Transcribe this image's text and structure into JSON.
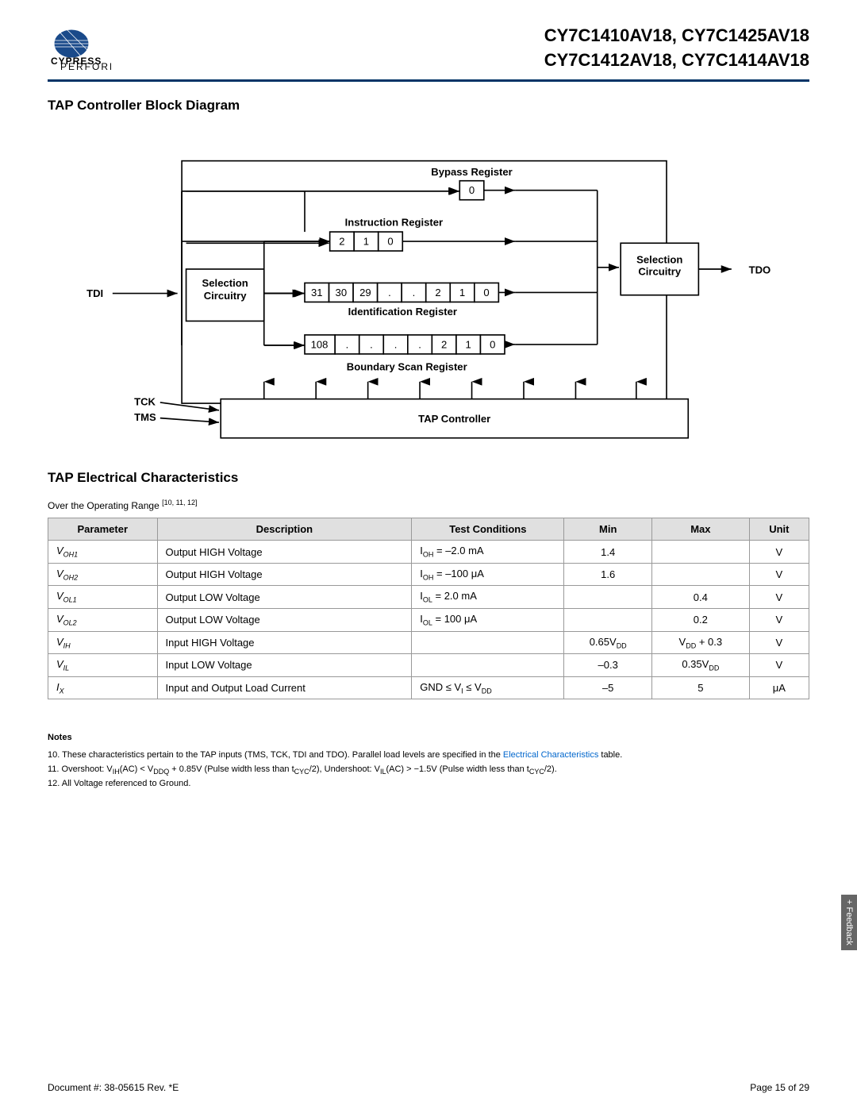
{
  "header": {
    "title_line1": "CY7C1410AV18, CY7C1425AV18",
    "title_line2": "CY7C1412AV18, CY7C1414AV18"
  },
  "diagram_section": {
    "title": "TAP Controller Block Diagram"
  },
  "table_section": {
    "title": "TAP Electrical Characteristics",
    "operating_range": "Over the Operating Range",
    "operating_range_sup": "[10, 11, 12]",
    "columns": [
      "Parameter",
      "Description",
      "Test Conditions",
      "Min",
      "Max",
      "Unit"
    ],
    "rows": [
      {
        "param": "V_OH1",
        "param_display": "V<sub>OH1</sub>",
        "description": "Output HIGH Voltage",
        "test_conditions": "I<sub>OH</sub> = –2.0 mA",
        "min": "1.4",
        "max": "",
        "unit": "V"
      },
      {
        "param": "V_OH2",
        "param_display": "V<sub>OH2</sub>",
        "description": "Output HIGH Voltage",
        "test_conditions": "I<sub>OH</sub> = –100 μA",
        "min": "1.6",
        "max": "",
        "unit": "V"
      },
      {
        "param": "V_OL1",
        "param_display": "V<sub>OL1</sub>",
        "description": "Output LOW Voltage",
        "test_conditions": "I<sub>OL</sub> = 2.0 mA",
        "min": "",
        "max": "0.4",
        "unit": "V"
      },
      {
        "param": "V_OL2",
        "param_display": "V<sub>OL2</sub>",
        "description": "Output LOW Voltage",
        "test_conditions": "I<sub>OL</sub> = 100 μA",
        "min": "",
        "max": "0.2",
        "unit": "V"
      },
      {
        "param": "V_IH",
        "param_display": "V<sub>IH</sub>",
        "description": "Input HIGH Voltage",
        "test_conditions": "",
        "min": "0.65V<sub>DD</sub>",
        "max": "V<sub>DD</sub> + 0.3",
        "unit": "V"
      },
      {
        "param": "V_IL",
        "param_display": "V<sub>IL</sub>",
        "description": "Input LOW Voltage",
        "test_conditions": "",
        "min": "–0.3",
        "max": "0.35V<sub>DD</sub>",
        "unit": "V"
      },
      {
        "param": "I_X",
        "param_display": "I<sub>X</sub>",
        "description": "Input and Output Load Current",
        "test_conditions": "GND ≤ V<sub>I</sub> ≤ V<sub>DD</sub>",
        "min": "–5",
        "max": "5",
        "unit": "μA"
      }
    ]
  },
  "notes": {
    "title": "Notes",
    "items": [
      "10. These characteristics pertain to the TAP inputs (TMS, TCK, TDI and TDO). Parallel load levels are specified in the Electrical Characteristics table.",
      "11. Overshoot: V_IH(AC) < V_DDQ + 0.85V (Pulse width less than t_CYC/2), Undershoot: V_IL(AC) > −1.5V (Pulse width less than t_CYC/2).",
      "12. All Voltage referenced to Ground."
    ]
  },
  "footer": {
    "doc_number": "Document #: 38-05615 Rev. *E",
    "page": "Page 15 of 29"
  },
  "feedback": {
    "label": "+ Feedback"
  }
}
